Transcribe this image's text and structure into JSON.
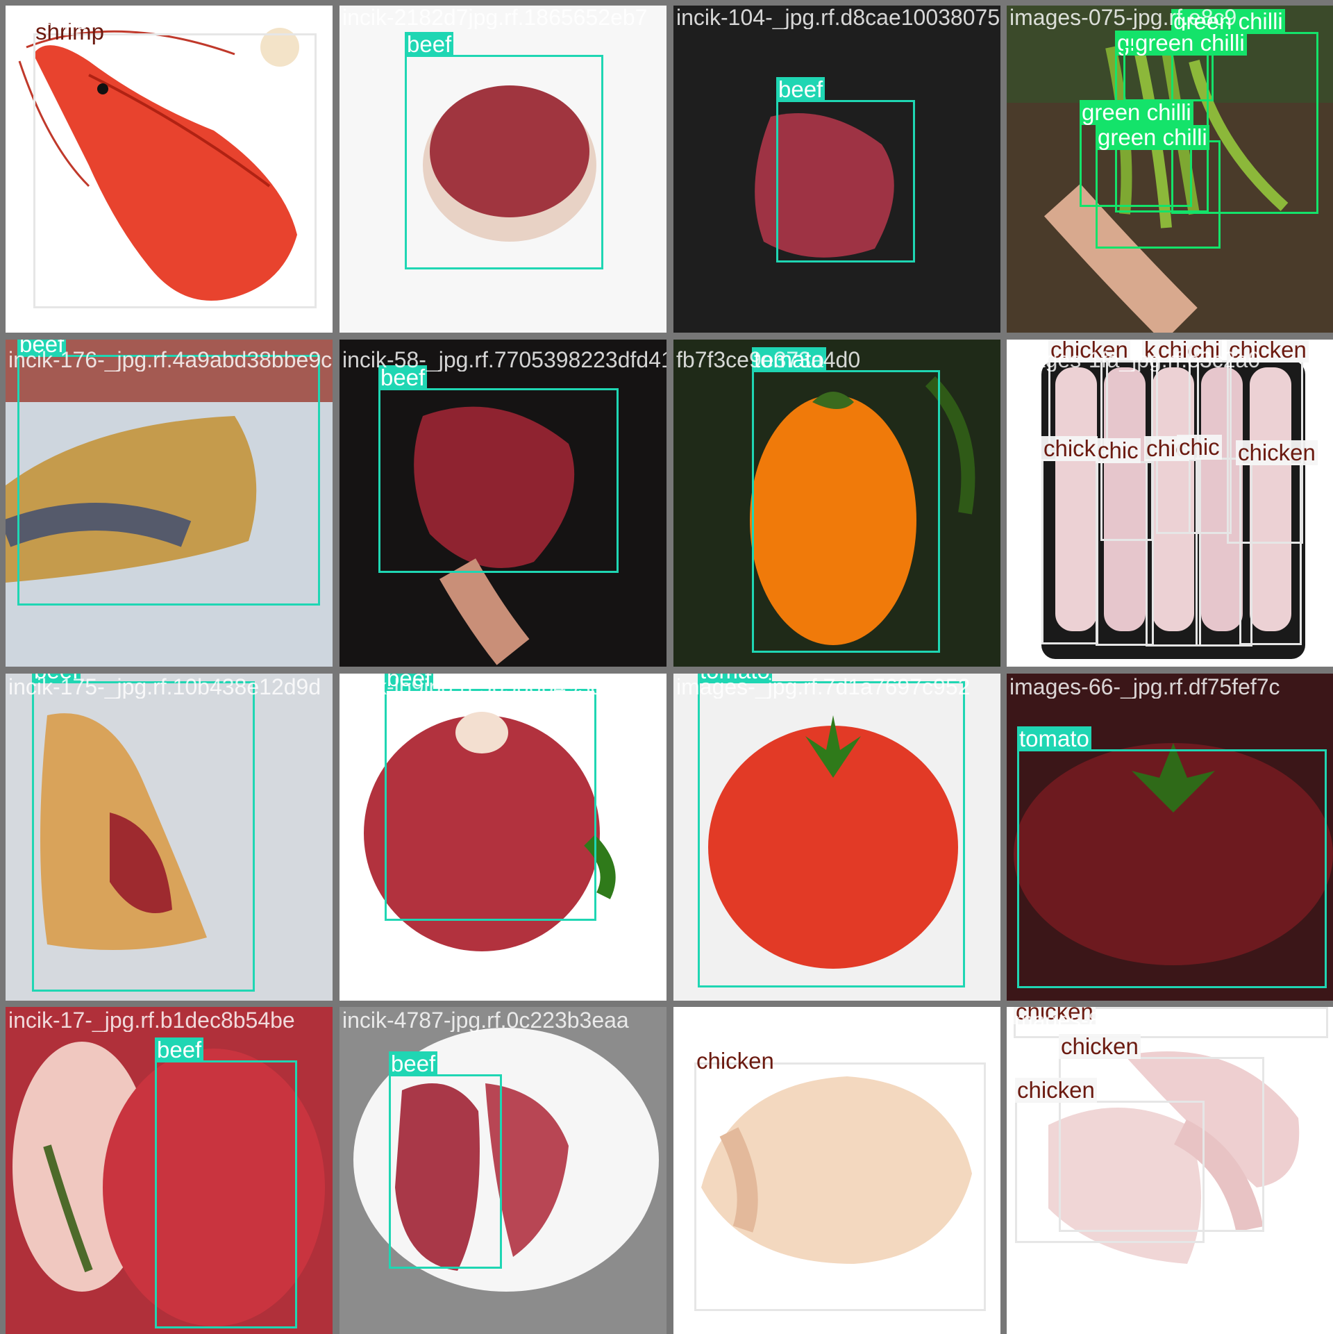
{
  "colors": {
    "beef": "#1fd6b3",
    "tomato": "#1fd6b3",
    "green_chilli": "#14e36a",
    "chicken": "#e6e6e6",
    "label_dark_text": "#6b1a10",
    "grid_background": "#777777"
  },
  "tiles": [
    {
      "filename": "-112-jpg.rf.f107efc5e3cb4362ia2282d7j34d",
      "labels": {
        "a": "shrimp"
      }
    },
    {
      "filename": "incik-2182d7jpg.rf.1865652eb7",
      "labels": {
        "a": "beef"
      }
    },
    {
      "filename": "incik-104-_jpg.rf.d8cae1003807578f75f4",
      "labels": {
        "a": "beef"
      }
    },
    {
      "filename": "images-075-jpg.rf.e8c9",
      "labels": {
        "a": "green chilli",
        "b": "gr",
        "c": "green chilli",
        "d": "green chilli",
        "e": "green chilli"
      }
    },
    {
      "filename": "incik-176-_jpg.rf.4a9abd38bbe9c658",
      "labels": {
        "a": "beef"
      }
    },
    {
      "filename": "incik-58-_jpg.rf.7705398223dfd41563d7ff",
      "labels": {
        "a": "beef"
      }
    },
    {
      "filename": "fb7f3ce9e373a4d0",
      "labels": {
        "a": "tomato"
      }
    },
    {
      "filename": "images-1fa_jpg.rf.e3c2a0",
      "labels": {
        "a": "chicken",
        "b": "k",
        "c": "chic",
        "d": "chi",
        "e": "chicken",
        "f": "chick",
        "g": "chic",
        "h": "chic",
        "i": "chic",
        "j": "chicken"
      }
    },
    {
      "filename": "incik-175-_jpg.rf.10b438e12d9d",
      "labels": {
        "a": "beef"
      }
    },
    {
      "filename": "incik-lb9jpg.rf.5b5b6b493d",
      "labels": {
        "a": "beef"
      }
    },
    {
      "filename": "images-_jpg.rf.7d1a7697c952",
      "labels": {
        "a": "tomato"
      }
    },
    {
      "filename": "images-66-_jpg.rf.df75fef7c",
      "labels": {
        "a": "tomato"
      }
    },
    {
      "filename": "incik-17-_jpg.rf.b1dec8b54be",
      "labels": {
        "a": "beef"
      }
    },
    {
      "filename": "incik-4787-jpg.rf.0c223b3eaa",
      "labels": {
        "a": "beef"
      }
    },
    {
      "filename": "images-88-jpg.rf.6f5a4aa7fbcf2913",
      "labels": {
        "a": "chicken"
      }
    },
    {
      "filename": "images-8a97jpg.rf.a67db68",
      "labels": {
        "a": "chicken",
        "b": "chicken",
        "c": "chicken"
      }
    }
  ]
}
